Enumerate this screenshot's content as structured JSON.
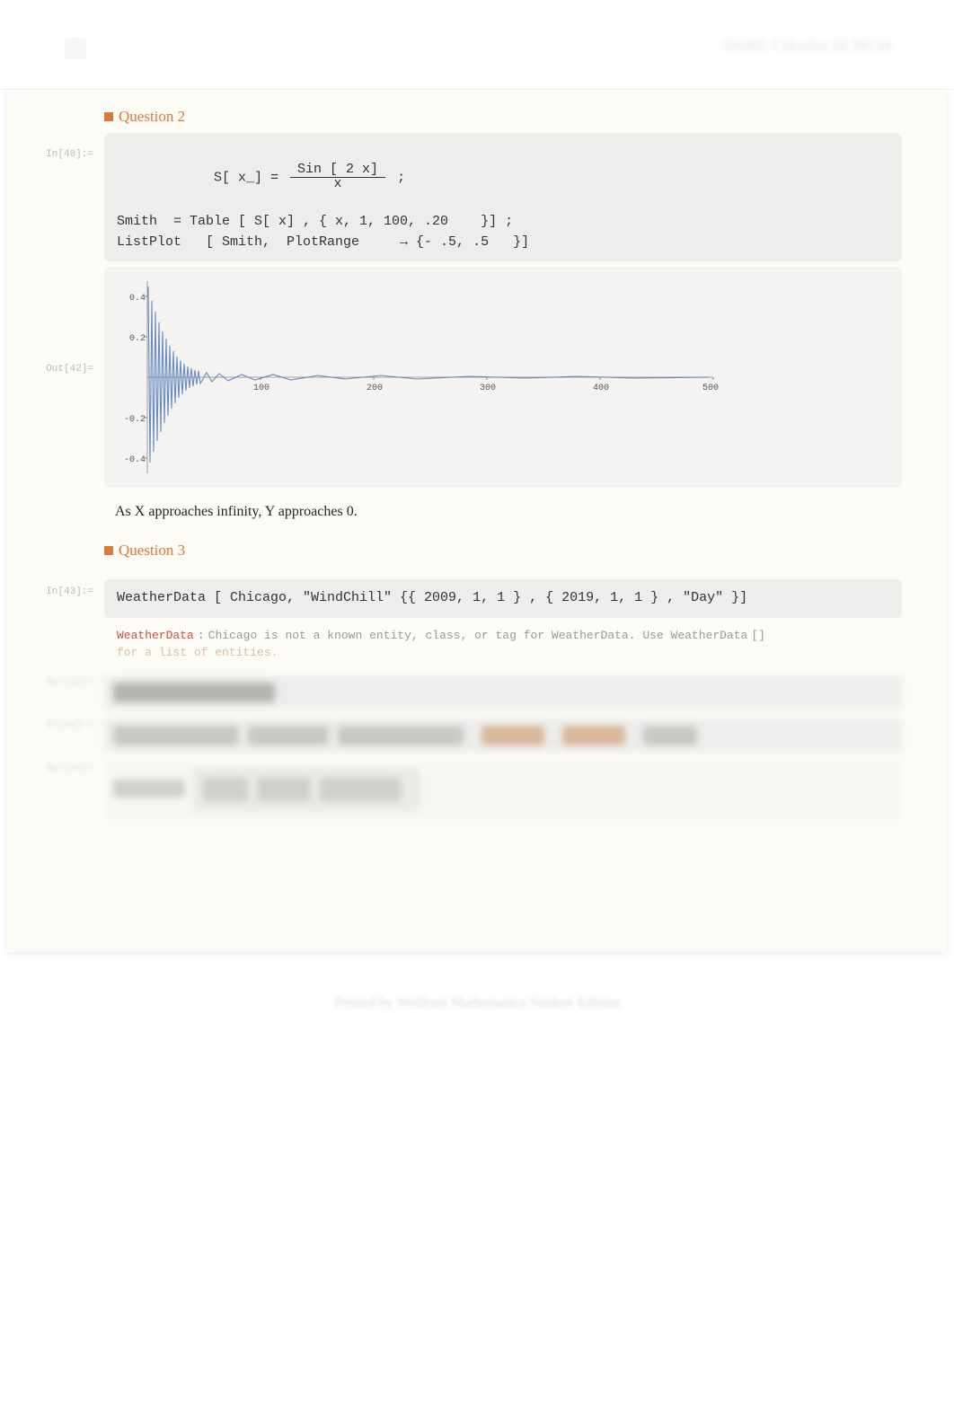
{
  "header": {
    "right_text": "DARE Calculus III M134"
  },
  "question2": {
    "title": "Question 2",
    "cell_in_label": "In[40]:=",
    "code": {
      "line1_a": "S[ x_] = ",
      "frac_top": "Sin [ 2 x]",
      "frac_bot": "x",
      "line1_b": " ;",
      "line2": "Smith  = Table [ S[ x] , { x, 1, 100, .20    }] ;",
      "line3": "ListPlot   [ Smith,  PlotRange     → {- .5, .5   }]"
    },
    "cell_out_label": "Out[42]=",
    "narrative": "As X approaches infinity, Y approaches 0."
  },
  "question3": {
    "title": "Question 3",
    "cell_in_label": "In[43]:=",
    "code": "WeatherData  [ Chicago, \"WindChill\"      {{ 2009, 1, 1  } ,  { 2019, 1, 1  } , \"Day\"  }]",
    "message": {
      "head": "WeatherData",
      "colon": ":",
      "body_a": "Chicago is not a known entity, class, or tag for WeatherData. Use WeatherData",
      "brackets": "[]",
      "link": "for a list of entities."
    }
  },
  "chart_data": {
    "type": "line",
    "title": "",
    "xlabel": "",
    "ylabel": "",
    "xlim": [
      0,
      500
    ],
    "ylim": [
      -0.5,
      0.5
    ],
    "x_ticks": [
      100,
      200,
      300,
      400,
      500
    ],
    "y_ticks": [
      -0.4,
      -0.2,
      0.2,
      0.4
    ],
    "description": "Damped oscillation of Sin(2x)/x sampled at step 0.20 from x=1 to 100 (≈496 points). Rapid oscillation with amplitude ~0.45 near left edge decaying toward 0 as index → 500.",
    "series": [
      {
        "name": "S[x]=Sin(2x)/x table",
        "envelope_samples": [
          {
            "index": 1,
            "amplitude": 0.45
          },
          {
            "index": 50,
            "amplitude": 0.09
          },
          {
            "index": 100,
            "amplitude": 0.047
          },
          {
            "index": 200,
            "amplitude": 0.024
          },
          {
            "index": 300,
            "amplitude": 0.016
          },
          {
            "index": 400,
            "amplitude": 0.012
          },
          {
            "index": 496,
            "amplitude": 0.01
          }
        ]
      }
    ]
  },
  "footer": "Printed by Wolfram Mathematica Student Edition"
}
